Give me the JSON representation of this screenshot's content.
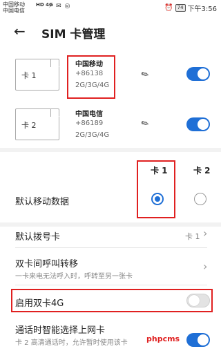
{
  "status_bar": {
    "carrier1": "中国移动",
    "carrier2": "中国电信",
    "badge": "HD 4G",
    "icons": "⚡ ✉ ◎",
    "alarm": "⏰",
    "battery": "74",
    "time": "下午3:56"
  },
  "header": {
    "back_icon": "←",
    "title": "SIM 卡管理"
  },
  "sims": [
    {
      "label": "卡 1",
      "carrier": "中国移动",
      "number": "+86138",
      "networks": "2G/3G/4G",
      "enabled": true
    },
    {
      "label": "卡 2",
      "carrier": "中国电信",
      "number": "+86189",
      "networks": "2G/3G/4G",
      "enabled": true
    }
  ],
  "edit_icon": "✎",
  "data_section": {
    "col1": "卡 1",
    "col2": "卡 2",
    "label": "默认移动数据",
    "selected": "卡 1"
  },
  "default_dial": {
    "label": "默认拨号卡",
    "value": "卡 1"
  },
  "forward": {
    "label": "双卡间呼叫转移",
    "sub": "一卡来电无法呼入时，呼转至另一张卡"
  },
  "dual_4g": {
    "label": "启用双卡4G",
    "enabled": false
  },
  "smart": {
    "label": "通话时智能选择上网卡",
    "sub": "卡 2 高清通话时，允许暂时使用该卡",
    "enabled": true
  },
  "chevron": "›",
  "watermark": "phpcms",
  "colors": {
    "accent": "#1f6fd6",
    "highlight": "#e02020"
  }
}
